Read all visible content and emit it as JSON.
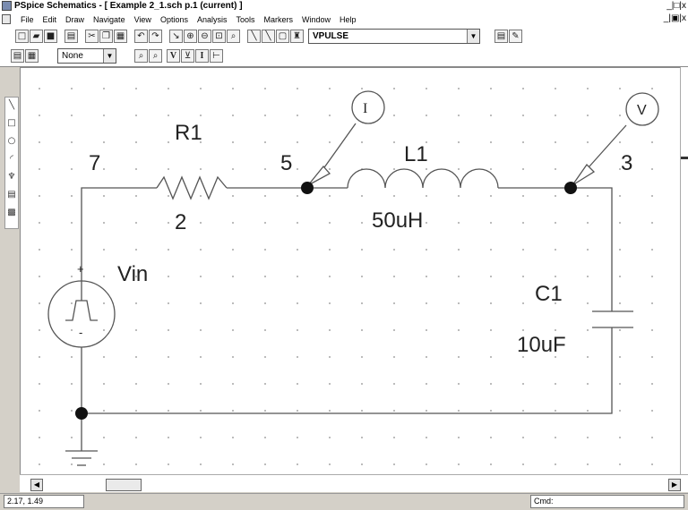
{
  "window": {
    "title": "PSpice Schematics - [ Example 2_1.sch  p.1 (current) ]",
    "controls": "_|□|x",
    "child_controls": "_|▣|x"
  },
  "menu": [
    "File",
    "Edit",
    "Draw",
    "Navigate",
    "View",
    "Options",
    "Analysis",
    "Tools",
    "Markers",
    "Window",
    "Help"
  ],
  "toolbar": {
    "part_combo": "VPULSE",
    "attribute_combo": "None",
    "probe_v": "V",
    "probe_i": "I"
  },
  "circuit": {
    "resistor": {
      "ref": "R1",
      "value": "2"
    },
    "inductor": {
      "ref": "L1",
      "value": "50uH"
    },
    "capacitor": {
      "ref": "C1",
      "value": "10uF"
    },
    "source": {
      "ref": "Vin",
      "plus": "+",
      "minus": "-"
    },
    "nodes": {
      "n7": "7",
      "n5": "5",
      "n3": "3"
    },
    "markers": {
      "current": "I",
      "voltage": "V"
    }
  },
  "status": {
    "coords": "2.17, 1.49",
    "cmd": "Cmd:"
  }
}
